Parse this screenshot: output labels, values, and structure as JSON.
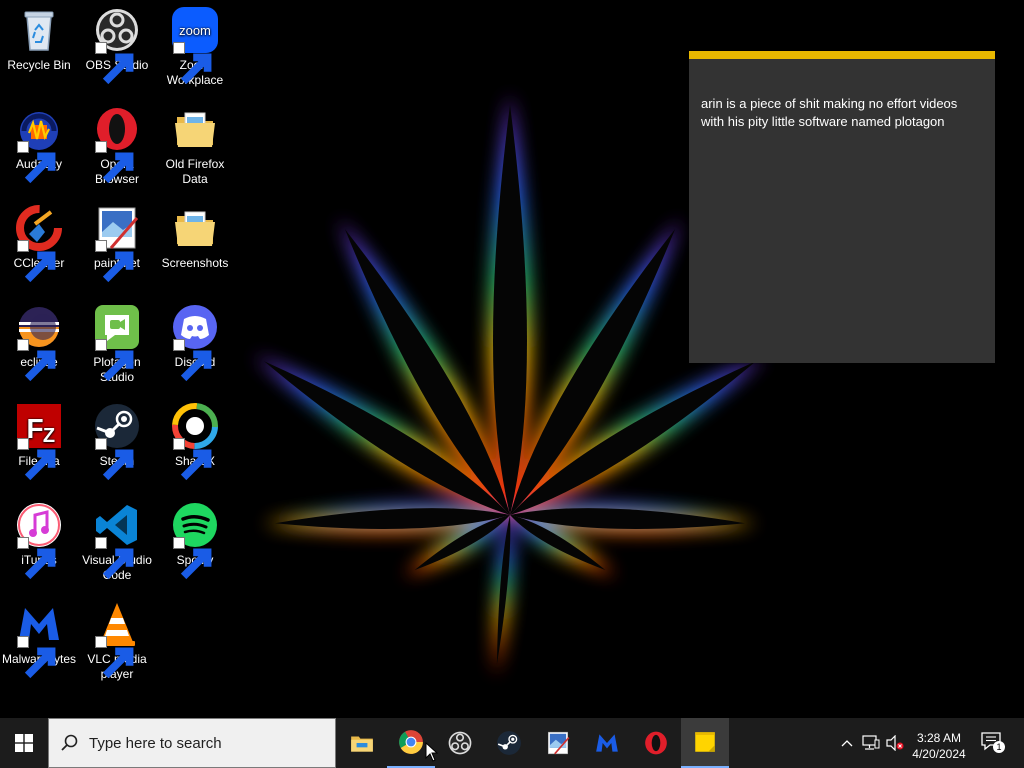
{
  "desktop": {
    "icons": [
      {
        "label": "Recycle Bin",
        "icon": "recycle-bin-icon",
        "shortcut": false
      },
      {
        "label": "OBS Studio",
        "icon": "obs-icon",
        "shortcut": true
      },
      {
        "label": "Zoom Workplace",
        "icon": "zoom-icon",
        "shortcut": true,
        "badge_text": "zoom"
      },
      {
        "label": "Audacity",
        "icon": "audacity-icon",
        "shortcut": true
      },
      {
        "label": "Opera Browser",
        "icon": "opera-icon",
        "shortcut": true
      },
      {
        "label": "Old Firefox Data",
        "icon": "folder-icon",
        "shortcut": false
      },
      {
        "label": "CCleaner",
        "icon": "ccleaner-icon",
        "shortcut": true
      },
      {
        "label": "paint.net",
        "icon": "paintnet-icon",
        "shortcut": true
      },
      {
        "label": "Screenshots",
        "icon": "folder-icon",
        "shortcut": false
      },
      {
        "label": "eclipse",
        "icon": "eclipse-icon",
        "shortcut": true
      },
      {
        "label": "Plotagon Studio",
        "icon": "plotagon-icon",
        "shortcut": true
      },
      {
        "label": "Discord",
        "icon": "discord-icon",
        "shortcut": true
      },
      {
        "label": "FileZilla",
        "icon": "filezilla-icon",
        "shortcut": true
      },
      {
        "label": "Steam",
        "icon": "steam-icon",
        "shortcut": true
      },
      {
        "label": "ShareX",
        "icon": "sharex-icon",
        "shortcut": true
      },
      {
        "label": "iTunes",
        "icon": "itunes-icon",
        "shortcut": true
      },
      {
        "label": "Visual Studio Code",
        "icon": "vscode-icon",
        "shortcut": true
      },
      {
        "label": "Spotify",
        "icon": "spotify-icon",
        "shortcut": true
      },
      {
        "label": "Malwarebytes",
        "icon": "malwarebytes-icon",
        "shortcut": true
      },
      {
        "label": "VLC media player",
        "icon": "vlc-icon",
        "shortcut": true
      }
    ]
  },
  "sticky_note": {
    "text": "arin is a piece of shit making no effort videos with his pity little software named plotagon",
    "accent": "#e8b800",
    "background": "#333333"
  },
  "taskbar": {
    "search_placeholder": "Type here to search",
    "apps": [
      {
        "name": "file-explorer",
        "icon": "file-explorer-icon",
        "state": "idle"
      },
      {
        "name": "chrome",
        "icon": "chrome-icon",
        "state": "running"
      },
      {
        "name": "obs",
        "icon": "obs-icon",
        "state": "idle"
      },
      {
        "name": "steam",
        "icon": "steam-icon",
        "state": "idle"
      },
      {
        "name": "paintnet",
        "icon": "paintnet-icon",
        "state": "idle"
      },
      {
        "name": "malwarebytes",
        "icon": "malwarebytes-icon",
        "state": "idle"
      },
      {
        "name": "opera",
        "icon": "opera-icon",
        "state": "idle"
      },
      {
        "name": "sticky-notes",
        "icon": "sticky-notes-icon",
        "state": "active"
      }
    ],
    "tray": {
      "time": "3:28 AM",
      "date": "4/20/2024",
      "notification_count": "1"
    }
  }
}
